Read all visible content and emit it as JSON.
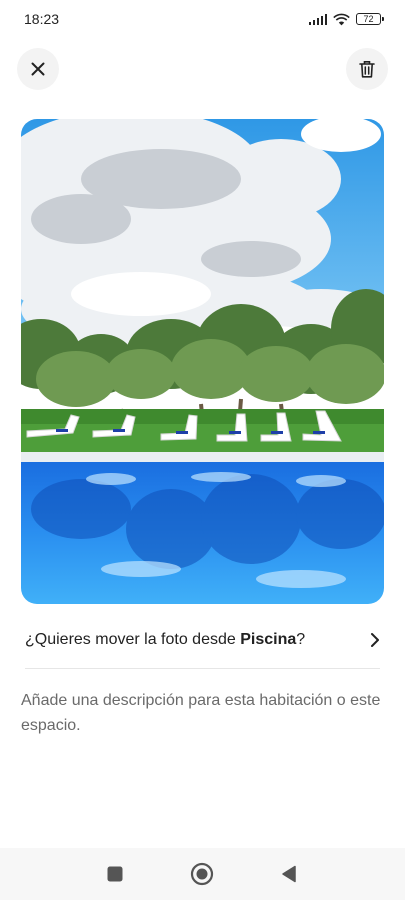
{
  "status_bar": {
    "time": "18:23",
    "battery": "72",
    "icons": [
      "signal-icon",
      "wifi-icon",
      "battery-icon"
    ]
  },
  "header": {
    "close_icon": "close-icon",
    "delete_icon": "trash-icon"
  },
  "photo": {
    "subject": "pool-photo"
  },
  "move_prompt": {
    "prefix": "¿Quieres mover la foto desde ",
    "room": "Piscina",
    "suffix": "?",
    "icon": "chevron-right-icon"
  },
  "description": {
    "placeholder": "Añade una descripción para esta habitación o este espacio."
  },
  "nav": {
    "icons": [
      "recents-icon",
      "home-icon",
      "back-icon"
    ]
  },
  "colors": {
    "text": "#222222",
    "muted": "#6a6a6a",
    "button_bg": "#f3f3f3",
    "divider": "#e6e6e6",
    "nav_bg": "#f7f7f7"
  }
}
